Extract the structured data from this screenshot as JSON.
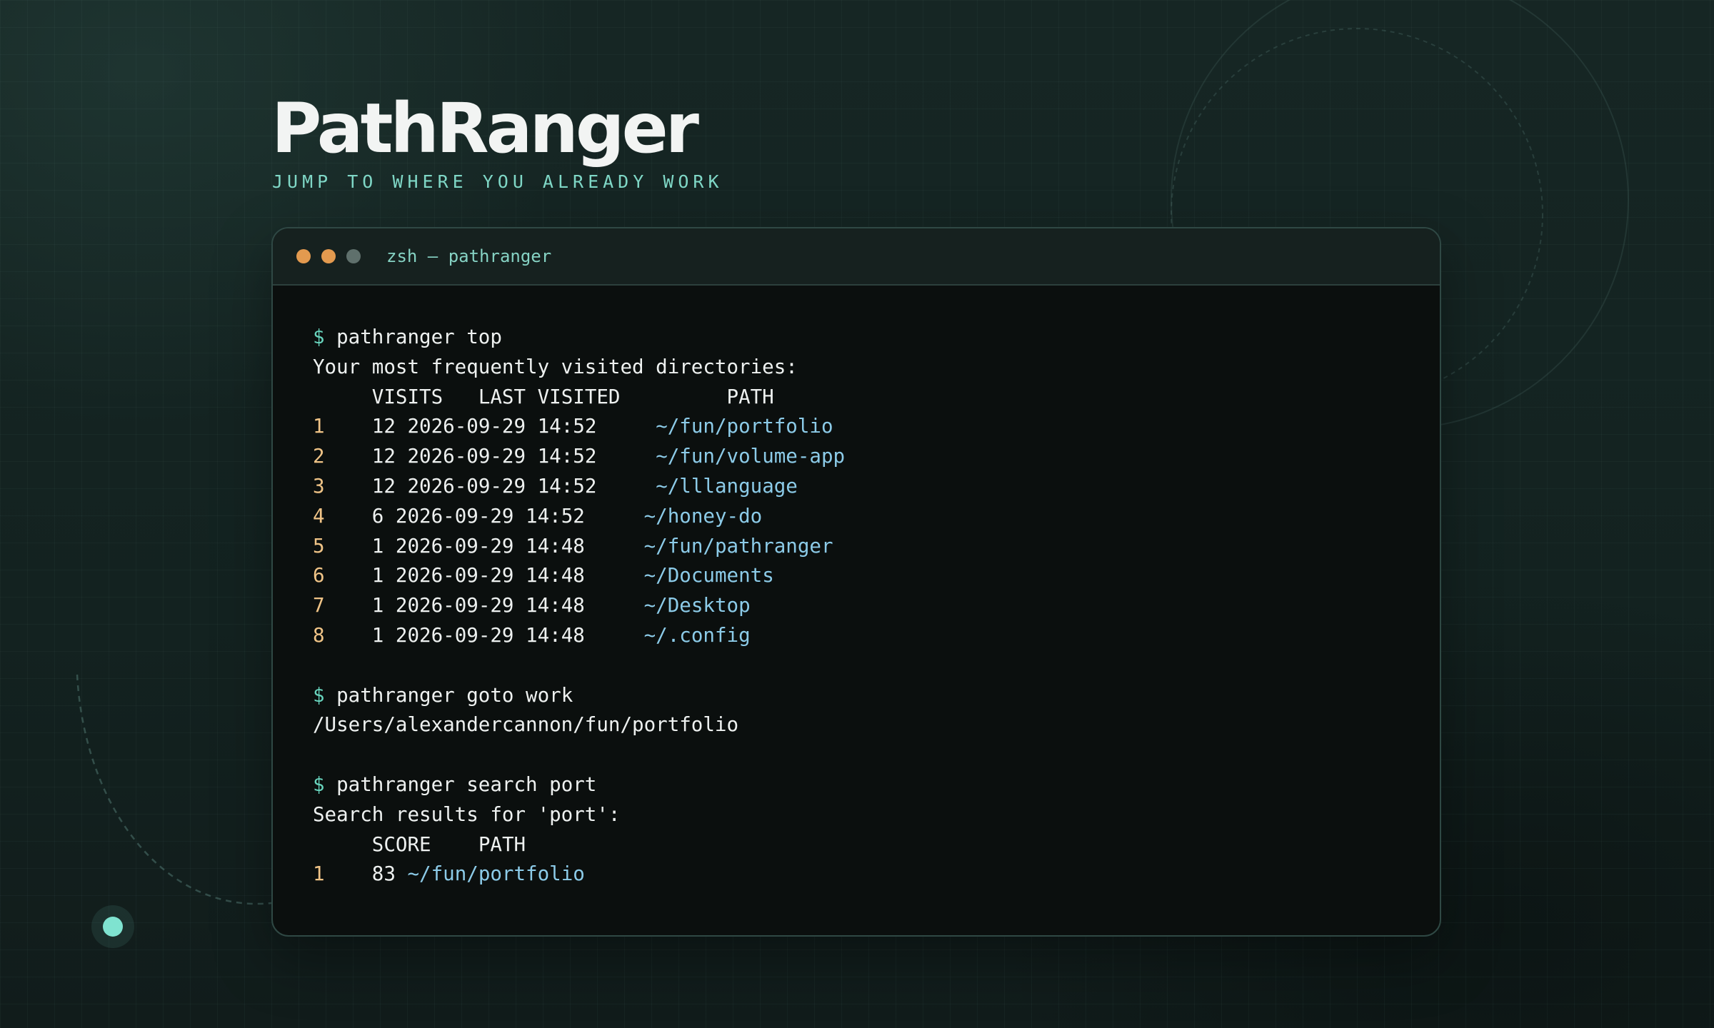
{
  "brand": {
    "title": "PathRanger",
    "tagline": "JUMP TO WHERE YOU ALREADY WORK"
  },
  "terminal": {
    "title": "zsh — pathranger",
    "prompt_symbol": "$",
    "top": {
      "command": "pathranger top",
      "heading": "Your most frequently visited directories:",
      "columns": [
        "VISITS",
        "LAST VISITED",
        "PATH"
      ],
      "rows": [
        {
          "rank": "1",
          "visits": "12",
          "last_visited": "2026-09-29 14:52",
          "path": "~/fun/portfolio"
        },
        {
          "rank": "2",
          "visits": "12",
          "last_visited": "2026-09-29 14:52",
          "path": "~/fun/volume-app"
        },
        {
          "rank": "3",
          "visits": "12",
          "last_visited": "2026-09-29 14:52",
          "path": "~/lllanguage"
        },
        {
          "rank": "4",
          "visits": "6",
          "last_visited": "2026-09-29 14:52",
          "path": "~/honey-do"
        },
        {
          "rank": "5",
          "visits": "1",
          "last_visited": "2026-09-29 14:48",
          "path": "~/fun/pathranger"
        },
        {
          "rank": "6",
          "visits": "1",
          "last_visited": "2026-09-29 14:48",
          "path": "~/Documents"
        },
        {
          "rank": "7",
          "visits": "1",
          "last_visited": "2026-09-29 14:48",
          "path": "~/Desktop"
        },
        {
          "rank": "8",
          "visits": "1",
          "last_visited": "2026-09-29 14:48",
          "path": "~/.config"
        }
      ]
    },
    "goto": {
      "command": "pathranger goto work",
      "output": "/Users/alexandercannon/fun/portfolio"
    },
    "search": {
      "command": "pathranger search port",
      "heading": "Search results for 'port':",
      "columns": [
        "SCORE",
        "PATH"
      ],
      "rows": [
        {
          "rank": "1",
          "score": "83",
          "path": "~/fun/portfolio"
        }
      ]
    }
  },
  "colors": {
    "accent": "#7fd7c6",
    "prompt": "#68d4bd",
    "rank": "#f0c487",
    "path": "#8ccbe8",
    "dot_orange": "#e39a4f",
    "dot_gray": "#5f706c"
  }
}
